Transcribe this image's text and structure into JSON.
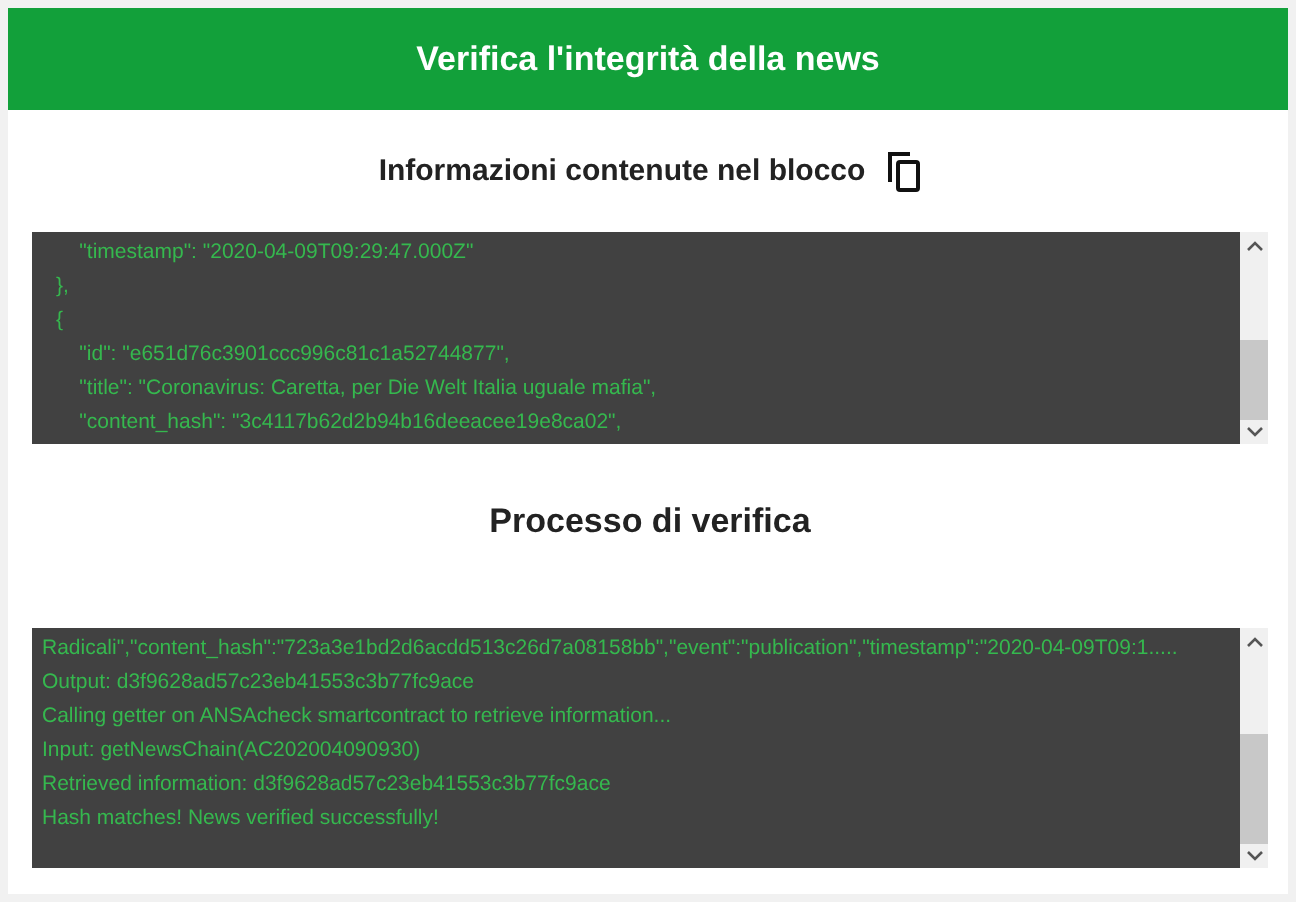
{
  "header": {
    "title": "Verifica l'integrità della news"
  },
  "block_info": {
    "title": "Informazioni contenute nel blocco",
    "lines": [
      "    \"timestamp\": \"2020-04-09T09:29:47.000Z\"",
      "},",
      "{",
      "    \"id\": \"e651d76c3901ccc996c81c1a52744877\",",
      "    \"title\": \"Coronavirus: Caretta, per Die Welt Italia uguale mafia\",",
      "    \"content_hash\": \"3c4117b62d2b94b16deeacee19e8ca02\","
    ]
  },
  "verification": {
    "title": "Processo di verifica",
    "lines": [
      "Radicali\",\"content_hash\":\"723a3e1bd2d6acdd513c26d7a08158bb\",\"event\":\"publication\",\"timestamp\":\"2020-04-09T09:1.....",
      "Output: d3f9628ad57c23eb41553c3b77fc9ace",
      "Calling getter on ANSAcheck smartcontract to retrieve information...",
      "Input: getNewsChain(AC202004090930)",
      "Retrieved information: d3f9628ad57c23eb41553c3b77fc9ace",
      "Hash matches! News verified successfully!"
    ]
  }
}
